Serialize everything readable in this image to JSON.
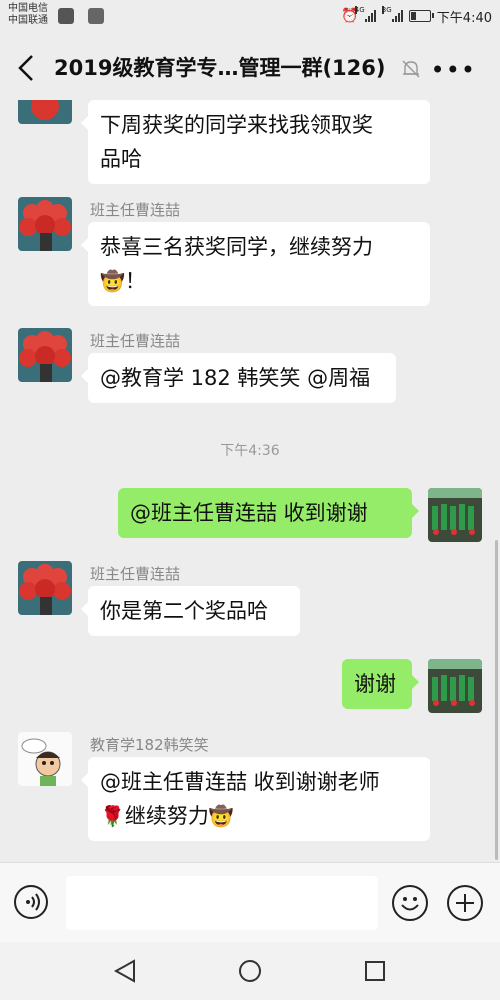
{
  "status_bar": {
    "carrier1": "中国电信",
    "carrier2": "中国联通",
    "net1": "4G",
    "net2": "3G",
    "time": "下午4:40"
  },
  "header": {
    "title": "2019级教育学专…管理一群(126)"
  },
  "messages": [
    {
      "text_line1": "下周获奖的同学来找我领取奖",
      "text_line2": "品哈"
    },
    {
      "sender": "班主任曹连喆",
      "text_line1": "恭喜三名获奖同学，继续努力",
      "text_line2": "！"
    },
    {
      "sender": "班主任曹连喆",
      "text": "@教育学 182 韩笑笑 @周福"
    },
    {
      "timestamp": "下午4:36"
    },
    {
      "text": "@班主任曹连喆  收到谢谢"
    },
    {
      "sender": "班主任曹连喆",
      "text": "你是第二个奖品哈"
    },
    {
      "text": "谢谢"
    },
    {
      "sender": "教育学182韩笑笑",
      "text_line1": "@班主任曹连喆  收到谢谢老师",
      "text_line2": "继续努力"
    }
  ],
  "colors": {
    "background": "#ededed",
    "self_bubble": "#95ec69",
    "other_bubble": "#ffffff"
  }
}
